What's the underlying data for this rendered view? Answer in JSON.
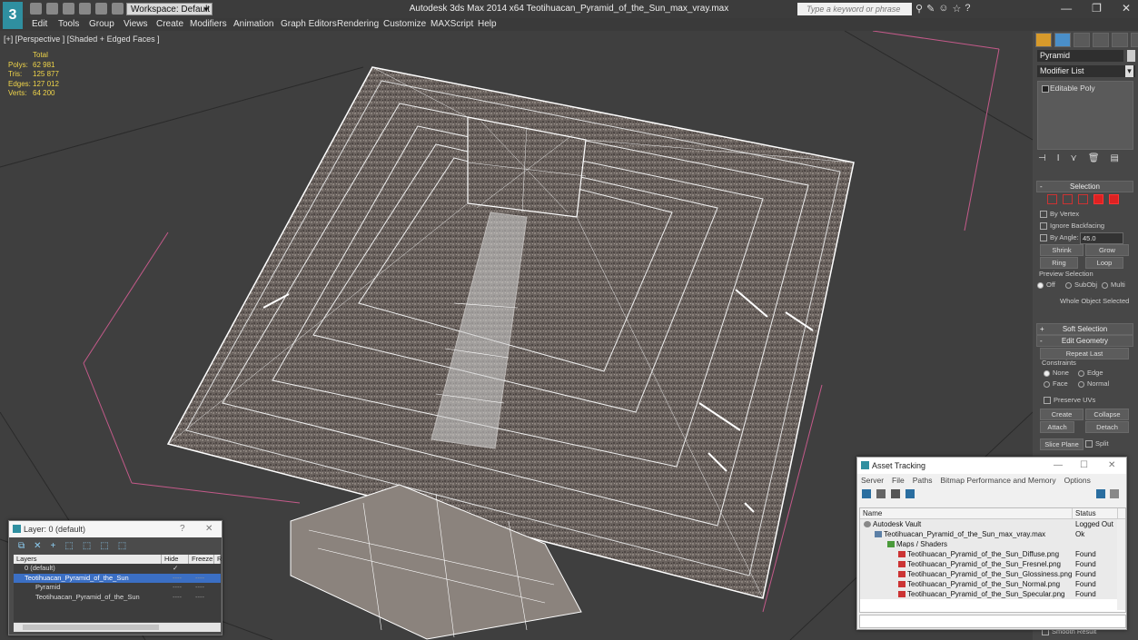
{
  "titlebar": {
    "workspace": "Workspace: Default",
    "title": "Autodesk 3ds Max  2014 x64      Teotihuacan_Pyramid_of_the_Sun_max_vray.max",
    "search_placeholder": "Type a keyword or phrase"
  },
  "menu": [
    "Edit",
    "Tools",
    "Group",
    "Views",
    "Create",
    "Modifiers",
    "Animation",
    "Graph Editors",
    "Rendering",
    "Customize",
    "MAXScript",
    "Help"
  ],
  "viewport": {
    "label": "[+] [Perspective ] [Shaded + Edged Faces ]",
    "stats": {
      "header": "Total",
      "rows": [
        {
          "k": "Polys:",
          "v": "62 981"
        },
        {
          "k": "Tris:",
          "v": "125 877"
        },
        {
          "k": "Edges:",
          "v": "127 012"
        },
        {
          "k": "Verts:",
          "v": "64 200"
        }
      ]
    }
  },
  "command_panel": {
    "object_name": "Pyramid",
    "modifier_list": "Modifier List",
    "stack_item": "Editable Poly",
    "selection": {
      "title": "Selection",
      "by_vertex": "By Vertex",
      "ignore_backfacing": "Ignore Backfacing",
      "by_angle": "By Angle:",
      "angle_value": "45.0",
      "shrink": "Shrink",
      "grow": "Grow",
      "ring": "Ring",
      "loop": "Loop",
      "preview_selection": "Preview Selection",
      "off": "Off",
      "subobj": "SubObj",
      "multi": "Multi",
      "status": "Whole Object Selected"
    },
    "soft_selection": "Soft Selection",
    "edit_geometry": {
      "title": "Edit Geometry",
      "repeat_last": "Repeat Last",
      "constraints": "Constraints",
      "none": "None",
      "edge": "Edge",
      "face": "Face",
      "normal": "Normal",
      "preserve_uvs": "Preserve UVs",
      "create": "Create",
      "collapse": "Collapse",
      "attach": "Attach",
      "detach": "Detach",
      "slice_plane": "Slice Plane",
      "split": "Split",
      "smooth": "Smooth Result"
    }
  },
  "layer_window": {
    "title": "Layer: 0 (default)",
    "help": "?",
    "columns": [
      "Layers",
      "Hide",
      "Freeze",
      "R"
    ],
    "rows": [
      {
        "name": "0 (default)",
        "indent": 12,
        "selected": false,
        "hide": "",
        "freeze": ""
      },
      {
        "name": "Teotihuacan_Pyramid_of_the_Sun",
        "indent": 12,
        "selected": true,
        "hide": "----",
        "freeze": "----"
      },
      {
        "name": "Pyramid",
        "indent": 24,
        "selected": false,
        "hide": "----",
        "freeze": "----"
      },
      {
        "name": "Teotihuacan_Pyramid_of_the_Sun",
        "indent": 24,
        "selected": false,
        "hide": "----",
        "freeze": "----"
      }
    ]
  },
  "asset_window": {
    "title": "Asset Tracking",
    "menu": [
      "Server",
      "File",
      "Paths",
      "Bitmap Performance and Memory",
      "Options"
    ],
    "columns": [
      "Name",
      "Status"
    ],
    "rows": [
      {
        "name": "Autodesk Vault",
        "status": "Logged Out",
        "indent": 4,
        "icon": "vault"
      },
      {
        "name": "Teotihuacan_Pyramid_of_the_Sun_max_vray.max",
        "status": "Ok",
        "indent": 16,
        "icon": "max"
      },
      {
        "name": "Maps / Shaders",
        "status": "",
        "indent": 30,
        "icon": "folder"
      },
      {
        "name": "Teotihuacan_Pyramid_of_the_Sun_Diffuse.png",
        "status": "Found",
        "indent": 42,
        "icon": "png"
      },
      {
        "name": "Teotihuacan_Pyramid_of_the_Sun_Fresnel.png",
        "status": "Found",
        "indent": 42,
        "icon": "png"
      },
      {
        "name": "Teotihuacan_Pyramid_of_the_Sun_Glossiness.png",
        "status": "Found",
        "indent": 42,
        "icon": "png"
      },
      {
        "name": "Teotihuacan_Pyramid_of_the_Sun_Normal.png",
        "status": "Found",
        "indent": 42,
        "icon": "png"
      },
      {
        "name": "Teotihuacan_Pyramid_of_the_Sun_Specular.png",
        "status": "Found",
        "indent": 42,
        "icon": "png"
      }
    ]
  }
}
